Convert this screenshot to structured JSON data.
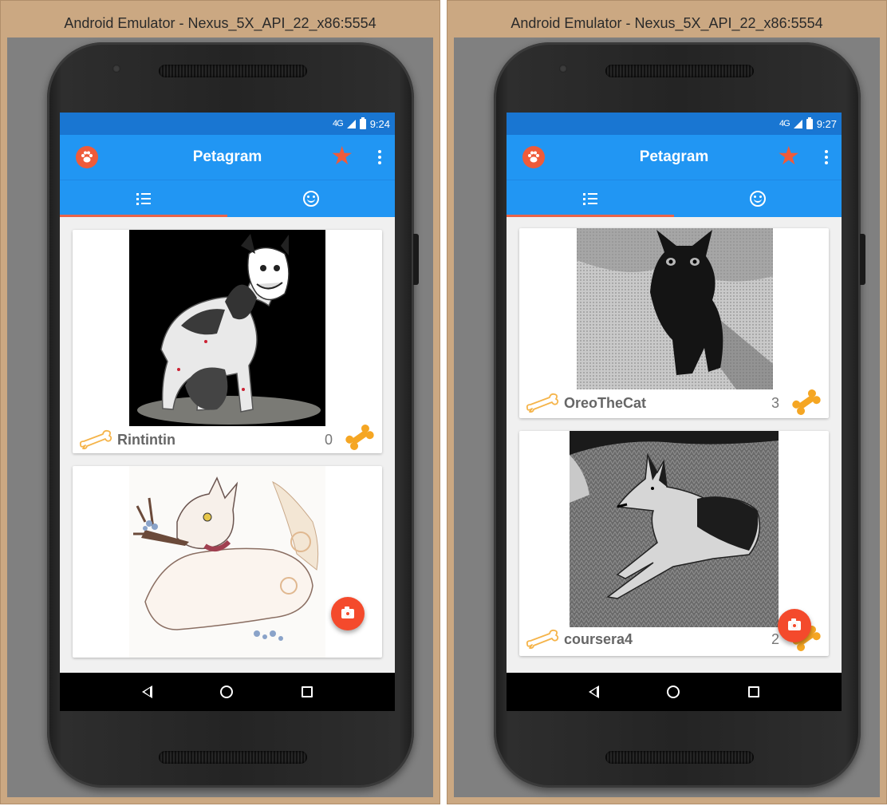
{
  "windows": [
    {
      "title": "Android Emulator - Nexus_5X_API_22_x86:5554",
      "status": {
        "signal": "4G",
        "time": "9:24"
      },
      "app": {
        "title": "Petagram"
      },
      "cards": [
        {
          "name": "Rintintin",
          "likes": "0",
          "photo": "husky-illustration"
        },
        {
          "name": "",
          "likes": "",
          "photo": "white-wolf-illustration"
        }
      ]
    },
    {
      "title": "Android Emulator - Nexus_5X_API_22_x86:5554",
      "status": {
        "signal": "4G",
        "time": "9:27"
      },
      "app": {
        "title": "Petagram"
      },
      "cards": [
        {
          "name": "OreoTheCat",
          "likes": "3",
          "photo": "black-kitten-photo"
        },
        {
          "name": "coursera4",
          "likes": "2",
          "photo": "german-shepherd-photo"
        }
      ]
    }
  ],
  "icons": {
    "app_logo": "paw-icon",
    "favorites": "star-icon",
    "overflow": "more-vert-icon",
    "tab_list": "list-icon",
    "tab_profile": "smiley-icon",
    "like_outline": "bone-outline-icon",
    "like_filled": "bone-filled-icon",
    "fab": "camera-icon",
    "nav_back": "back-icon",
    "nav_home": "home-icon",
    "nav_recent": "recents-icon"
  },
  "colors": {
    "status_bar": "#1976d2",
    "app_bar": "#2196f3",
    "accent": "#ef5b3a",
    "tab_indicator": "#e8644a",
    "bone": "#f5a623",
    "emulator_frame": "#cba882"
  }
}
